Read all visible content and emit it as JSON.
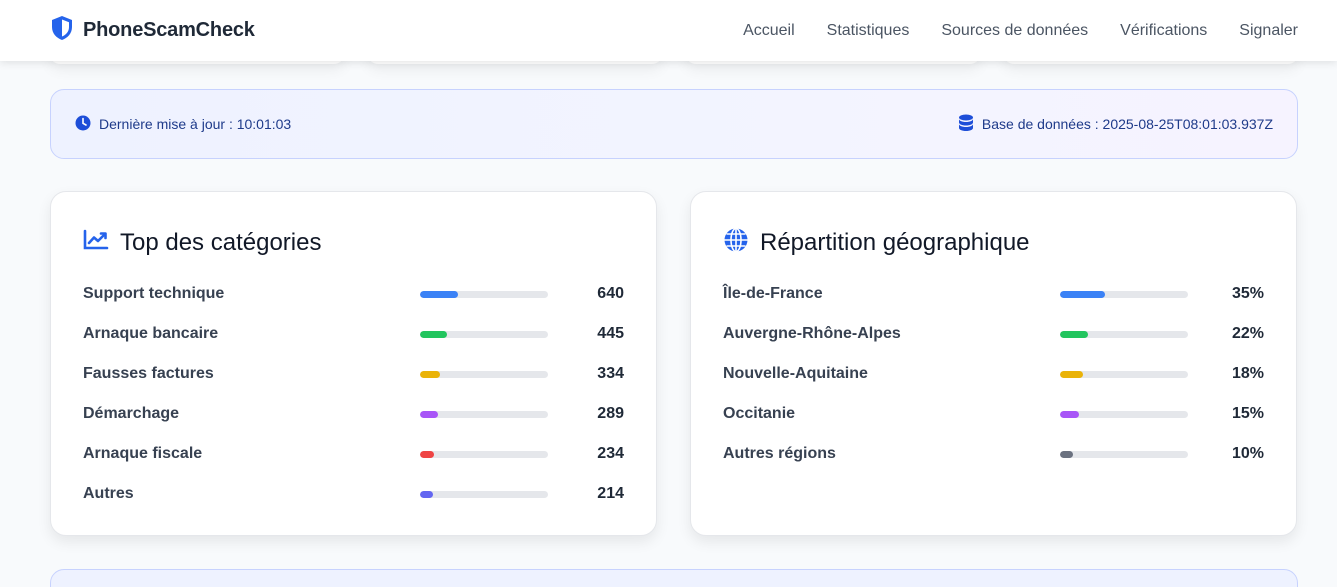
{
  "header": {
    "brand": "PhoneScamCheck",
    "nav": [
      "Accueil",
      "Statistiques",
      "Sources de données",
      "Vérifications",
      "Signaler"
    ]
  },
  "info_bar": {
    "last_update": "Dernière mise à jour : 10:01:03",
    "database": "Base de données : 2025-08-25T08:01:03.937Z"
  },
  "categories_card": {
    "title": "Top des catégories",
    "rows": [
      {
        "label": "Support technique",
        "value": "640",
        "fill": 0.3,
        "color": "#3b82f6"
      },
      {
        "label": "Arnaque bancaire",
        "value": "445",
        "fill": 0.21,
        "color": "#22c55e"
      },
      {
        "label": "Fausses factures",
        "value": "334",
        "fill": 0.16,
        "color": "#eab308"
      },
      {
        "label": "Démarchage",
        "value": "289",
        "fill": 0.14,
        "color": "#a855f7"
      },
      {
        "label": "Arnaque fiscale",
        "value": "234",
        "fill": 0.11,
        "color": "#ef4444"
      },
      {
        "label": "Autres",
        "value": "214",
        "fill": 0.1,
        "color": "#6366f1"
      }
    ]
  },
  "geo_card": {
    "title": "Répartition géographique",
    "rows": [
      {
        "label": "Île-de-France",
        "value": "35%",
        "fill": 0.35,
        "color": "#3b82f6"
      },
      {
        "label": "Auvergne-Rhône-Alpes",
        "value": "22%",
        "fill": 0.22,
        "color": "#22c55e"
      },
      {
        "label": "Nouvelle-Aquitaine",
        "value": "18%",
        "fill": 0.18,
        "color": "#eab308"
      },
      {
        "label": "Occitanie",
        "value": "15%",
        "fill": 0.15,
        "color": "#a855f7"
      },
      {
        "label": "Autres régions",
        "value": "10%",
        "fill": 0.1,
        "color": "#6b7280"
      }
    ]
  }
}
